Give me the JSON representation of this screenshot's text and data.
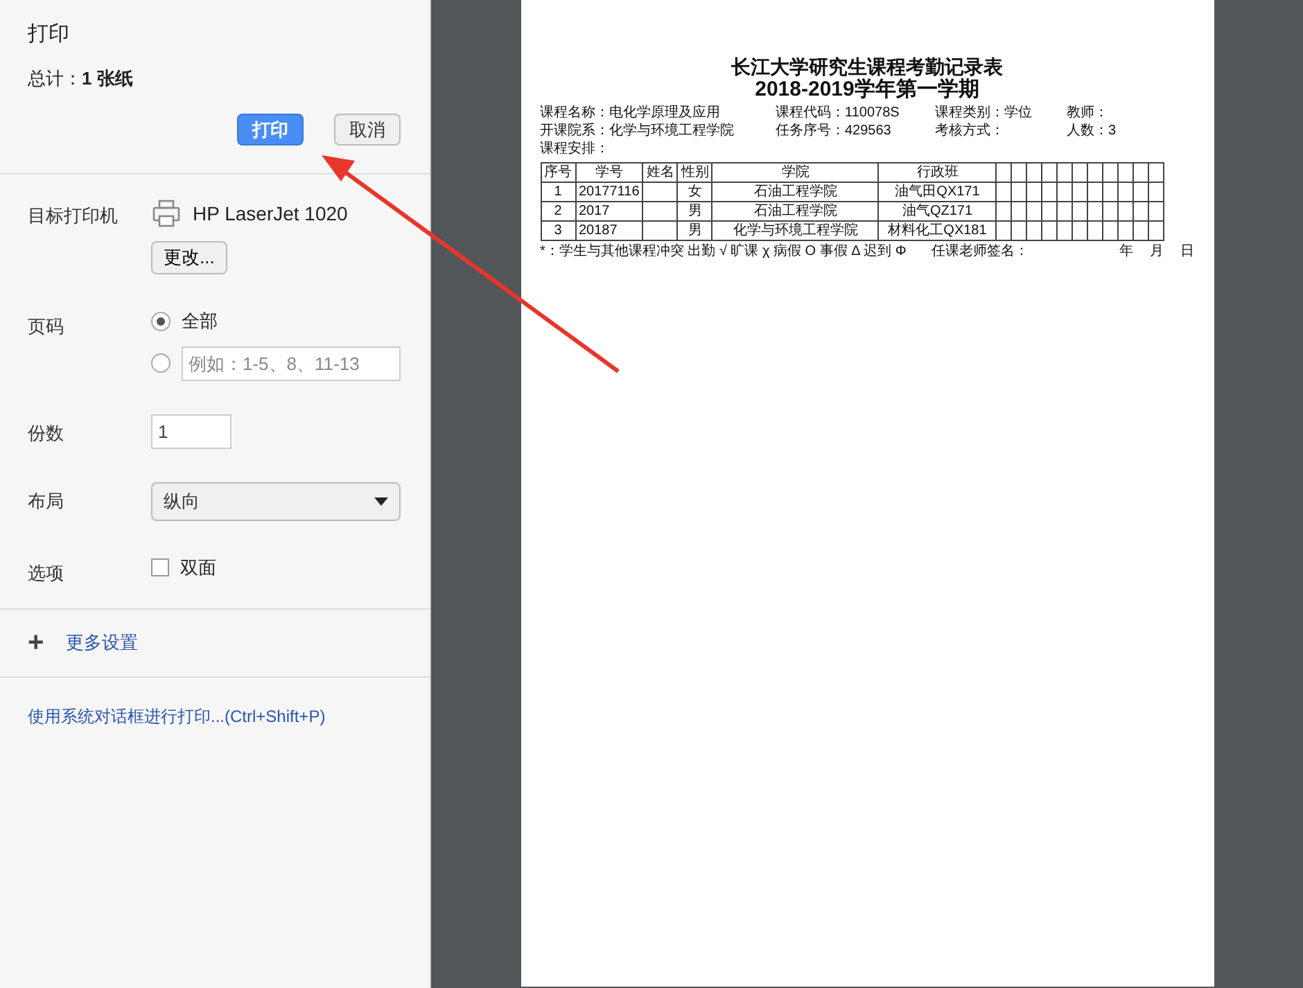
{
  "header": {
    "title": "打印",
    "total_label": "总计：",
    "total_value": "1 张纸",
    "buttons": [
      {
        "label": "打印",
        "kind": "primary"
      },
      {
        "label": "取消",
        "kind": "secondary"
      }
    ]
  },
  "settings": [
    {
      "kind": "printer",
      "label": "目标打印机",
      "printer": "HP LaserJet 1020",
      "button": "更改..."
    },
    {
      "kind": "pages",
      "label": "页码",
      "options": [
        {
          "kind": "all",
          "label": "全部",
          "selected": true
        },
        {
          "kind": "custom",
          "placeholder": "例如：1-5、8、11-13",
          "selected": false
        }
      ]
    },
    {
      "kind": "copies",
      "label": "份数",
      "value": "1"
    },
    {
      "kind": "layout",
      "label": "布局",
      "value": "纵向"
    },
    {
      "kind": "options",
      "label": "选项",
      "checkbox": {
        "label": "双面",
        "checked": false
      }
    }
  ],
  "more_settings": {
    "icon": "+",
    "label": "更多设置"
  },
  "system_dialog_link": "使用系统对话框进行打印...(Ctrl+Shift+P)",
  "document": {
    "title": "长江大学研究生课程考勤记录表",
    "subtitle": "2018-2019学年第一学期",
    "info": [
      [
        "课程名称：电化学原理及应用",
        "课程代码：110078S",
        "课程类别：学位",
        "教师："
      ],
      [
        "开课院系：化学与环境工程学院",
        "任务序号：429563",
        "考核方式：",
        "人数：3"
      ],
      [
        "课程安排："
      ]
    ],
    "columns": [
      "序号",
      "学号",
      "姓名",
      "性别",
      "学院",
      "行政班"
    ],
    "rows": [
      [
        "1",
        "20177116",
        "",
        "女",
        "石油工程学院",
        "油气田QX171"
      ],
      [
        "2",
        "2017",
        "",
        "男",
        "石油工程学院",
        "油气QZ171"
      ],
      [
        "3",
        "20187",
        "",
        "男",
        "化学与环境工程学院",
        "材料化工QX181"
      ]
    ],
    "legend": "*：学生与其他课程冲突 出勤 √ 旷课 χ 病假 O 事假 Δ 迟到 Φ",
    "signature": "任课老师签名：",
    "date": [
      "年",
      "月",
      "日"
    ]
  }
}
